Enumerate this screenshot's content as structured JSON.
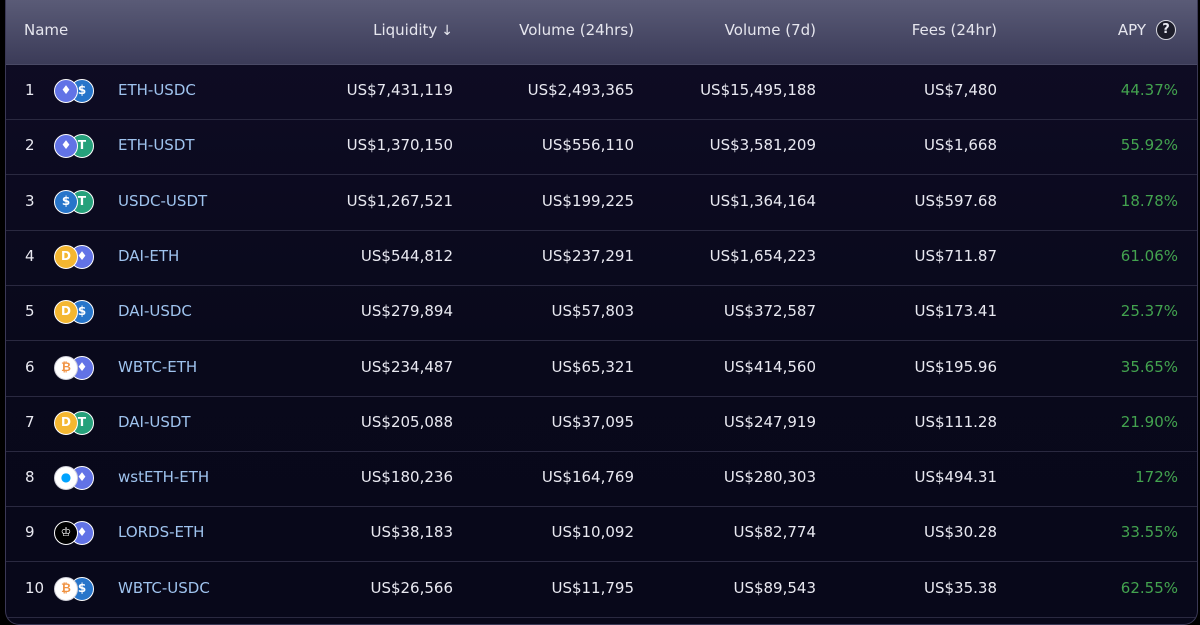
{
  "headers": {
    "name": "Name",
    "liquidity": "Liquidity",
    "liquidity_sort_icon": "arrow-down-icon",
    "volume_24h": "Volume (24hrs)",
    "volume_7d": "Volume (7d)",
    "fees_24h": "Fees (24hr)",
    "apy": "APY",
    "apy_help_icon": "question-circle-icon",
    "apy_help_glyph": "?"
  },
  "colors": {
    "pair_link": "#9fc3ee",
    "apy_green": "#43a34f",
    "eth": "#6273e6",
    "usdc": "#2775ca",
    "usdt": "#26a17b",
    "dai": "#f4b731",
    "wbtc": "#ffffff",
    "wsteth": "#ffffff",
    "lords": "#000000"
  },
  "rows": [
    {
      "rank": "1",
      "pair": "ETH-USDC",
      "liquidity": "US$7,431,119",
      "volume_24h": "US$2,493,365",
      "volume_7d": "US$15,495,188",
      "fees_24h": "US$7,480",
      "apy": "44.37%",
      "token_a": "eth",
      "token_b": "usdc",
      "glyph_a": "♦",
      "glyph_b": "$"
    },
    {
      "rank": "2",
      "pair": "ETH-USDT",
      "liquidity": "US$1,370,150",
      "volume_24h": "US$556,110",
      "volume_7d": "US$3,581,209",
      "fees_24h": "US$1,668",
      "apy": "55.92%",
      "token_a": "eth",
      "token_b": "usdt",
      "glyph_a": "♦",
      "glyph_b": "T"
    },
    {
      "rank": "3",
      "pair": "USDC-USDT",
      "liquidity": "US$1,267,521",
      "volume_24h": "US$199,225",
      "volume_7d": "US$1,364,164",
      "fees_24h": "US$597.68",
      "apy": "18.78%",
      "token_a": "usdc",
      "token_b": "usdt",
      "glyph_a": "$",
      "glyph_b": "T"
    },
    {
      "rank": "4",
      "pair": "DAI-ETH",
      "liquidity": "US$544,812",
      "volume_24h": "US$237,291",
      "volume_7d": "US$1,654,223",
      "fees_24h": "US$711.87",
      "apy": "61.06%",
      "token_a": "dai",
      "token_b": "eth",
      "glyph_a": "D",
      "glyph_b": "♦"
    },
    {
      "rank": "5",
      "pair": "DAI-USDC",
      "liquidity": "US$279,894",
      "volume_24h": "US$57,803",
      "volume_7d": "US$372,587",
      "fees_24h": "US$173.41",
      "apy": "25.37%",
      "token_a": "dai",
      "token_b": "usdc",
      "glyph_a": "D",
      "glyph_b": "$"
    },
    {
      "rank": "6",
      "pair": "WBTC-ETH",
      "liquidity": "US$234,487",
      "volume_24h": "US$65,321",
      "volume_7d": "US$414,560",
      "fees_24h": "US$195.96",
      "apy": "35.65%",
      "token_a": "wbtc",
      "token_b": "eth",
      "glyph_a": "₿",
      "glyph_b": "♦"
    },
    {
      "rank": "7",
      "pair": "DAI-USDT",
      "liquidity": "US$205,088",
      "volume_24h": "US$37,095",
      "volume_7d": "US$247,919",
      "fees_24h": "US$111.28",
      "apy": "21.90%",
      "token_a": "dai",
      "token_b": "usdt",
      "glyph_a": "D",
      "glyph_b": "T"
    },
    {
      "rank": "8",
      "pair": "wstETH-ETH",
      "liquidity": "US$180,236",
      "volume_24h": "US$164,769",
      "volume_7d": "US$280,303",
      "fees_24h": "US$494.31",
      "apy": "172%",
      "token_a": "wsteth",
      "token_b": "eth",
      "glyph_a": "●",
      "glyph_b": "♦"
    },
    {
      "rank": "9",
      "pair": "LORDS-ETH",
      "liquidity": "US$38,183",
      "volume_24h": "US$10,092",
      "volume_7d": "US$82,774",
      "fees_24h": "US$30.28",
      "apy": "33.55%",
      "token_a": "lords",
      "token_b": "eth",
      "glyph_a": "♔",
      "glyph_b": "♦"
    },
    {
      "rank": "10",
      "pair": "WBTC-USDC",
      "liquidity": "US$26,566",
      "volume_24h": "US$11,795",
      "volume_7d": "US$89,543",
      "fees_24h": "US$35.38",
      "apy": "62.55%",
      "token_a": "wbtc",
      "token_b": "usdc",
      "glyph_a": "₿",
      "glyph_b": "$"
    }
  ]
}
